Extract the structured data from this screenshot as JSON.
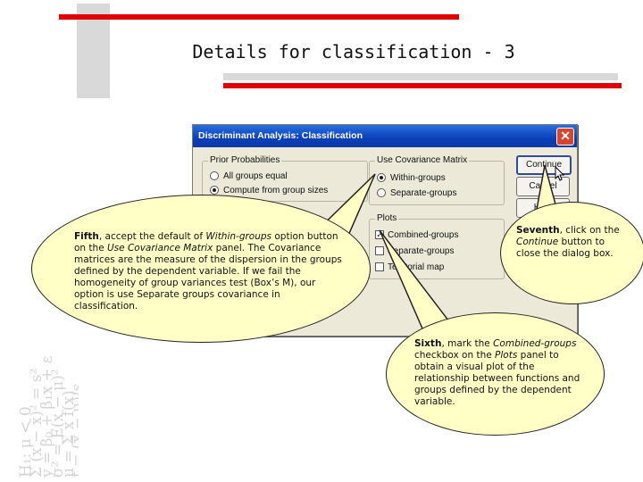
{
  "slide": {
    "title": "Details for classification - 3",
    "background_math": [
      "H₁: μ < 0",
      "Σ (x − x̄)² = s²",
      "y = β₀ + β₁x + ε",
      "σ² = E(x − μ)²",
      "μ = Σ x f(x)",
      "t = (x̄ − μ)/s"
    ]
  },
  "dialog": {
    "title": "Discriminant Analysis: Classification",
    "prior_probabilities": {
      "legend": "Prior Probabilities",
      "options": [
        "All groups equal",
        "Compute from group sizes"
      ],
      "selected": "Compute from group sizes"
    },
    "covariance_matrix": {
      "legend": "Use Covariance Matrix",
      "options": [
        "Within-groups",
        "Separate-groups"
      ],
      "selected": "Within-groups"
    },
    "plots": {
      "legend": "Plots",
      "options": [
        {
          "label": "Combined-groups",
          "checked": true
        },
        {
          "label": "Separate-groups",
          "checked": false
        },
        {
          "label": "Territorial map",
          "checked": false
        }
      ]
    },
    "buttons": {
      "continue": "Continue",
      "cancel": "Cancel",
      "help": "Help"
    }
  },
  "callouts": {
    "fifth": {
      "step": "Fifth",
      "t1": ", accept the default of ",
      "e1": "Within-groups",
      "t2": " option button on the ",
      "e2": "Use Covariance Matrix",
      "t3": " panel. The Covariance matrices are the measure of the dispersion in the groups defined by the dependent variable. If we fail the homogeneity of group variances test (Box’s M), our option is use Separate groups covariance in classification."
    },
    "seventh": {
      "step": "Seventh",
      "t1": ", click on the ",
      "e1": "Continue",
      "t2": " button to close the dialog box."
    },
    "sixth": {
      "step": "Sixth",
      "t1": ", mark the ",
      "e1": "Combined-groups",
      "t2": " checkbox on the ",
      "e2": "Plots",
      "t3": " panel to obtain a visual plot of the relationship between functions and groups defined by the dependent variable."
    }
  },
  "colors": {
    "accent_red": "#e00000",
    "callout_fill": "#ffffc6",
    "titlebar_blue": "#0a3fb8"
  }
}
